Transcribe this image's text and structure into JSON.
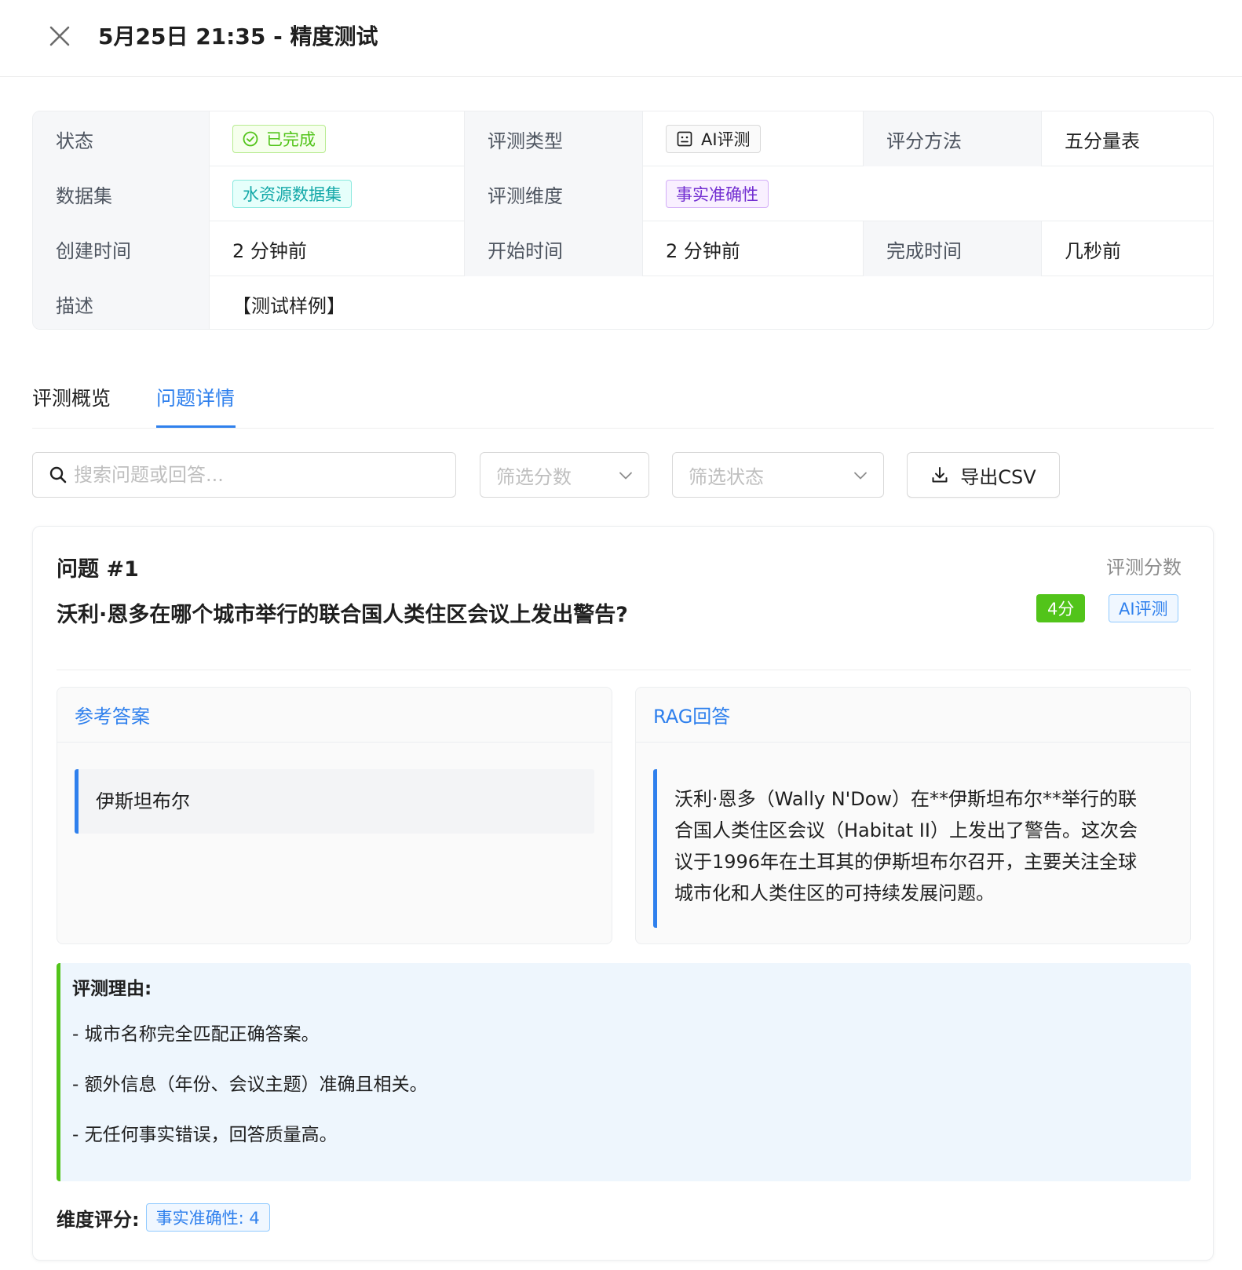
{
  "header": {
    "title": "5月25日 21:35 - 精度测试"
  },
  "details": {
    "status_label": "状态",
    "status_value": "已完成",
    "eval_type_label": "评测类型",
    "eval_type_value": "AI评测",
    "score_method_label": "评分方法",
    "score_method_value": "五分量表",
    "dataset_label": "数据集",
    "dataset_value": "水资源数据集",
    "dimension_label": "评测维度",
    "dimension_value": "事实准确性",
    "created_label": "创建时间",
    "created_value": "2 分钟前",
    "started_label": "开始时间",
    "started_value": "2 分钟前",
    "finished_label": "完成时间",
    "finished_value": "几秒前",
    "description_label": "描述",
    "description_value": "【测试样例】"
  },
  "tabs": [
    {
      "label": "评测概览",
      "active": false
    },
    {
      "label": "问题详情",
      "active": true
    }
  ],
  "filters": {
    "search_placeholder": "搜索问题或回答...",
    "score_placeholder": "筛选分数",
    "status_placeholder": "筛选状态",
    "export_label": "导出CSV"
  },
  "question": {
    "number": "问题 #1",
    "text": "沃利·恩多在哪个城市举行的联合国人类住区会议上发出警告?",
    "score_label": "评测分数",
    "score": "4分",
    "method": "AI评测",
    "reference_title": "参考答案",
    "reference_answer": "伊斯坦布尔",
    "rag_title": "RAG回答",
    "rag_answer": "沃利·恩多（Wally N'Dow）在**伊斯坦布尔**举行的联合国人类住区会议（Habitat II）上发出了警告。这次会议于1996年在土耳其的伊斯坦布尔召开，主要关注全球城市化和人类住区的可持续发展问题。",
    "reason_title": "评测理由:",
    "reasons": [
      "- 城市名称完全匹配正确答案。",
      "- 额外信息（年份、会议主题）准确且相关。",
      "- 无任何事实错误，回答质量高。"
    ],
    "dimension_score_label": "维度评分:",
    "dimension_score": "事实准确性: 4"
  },
  "colors": {
    "primary": "#2f80ed",
    "success": "#52c41a",
    "purple": "#722ed1",
    "cyan": "#13a8a8"
  },
  "icons": {
    "close": "close-icon",
    "status": "check-circle-icon",
    "eval_type": "robot-icon",
    "search": "search-icon",
    "dropdown": "chevron-down-icon",
    "export": "download-icon"
  }
}
